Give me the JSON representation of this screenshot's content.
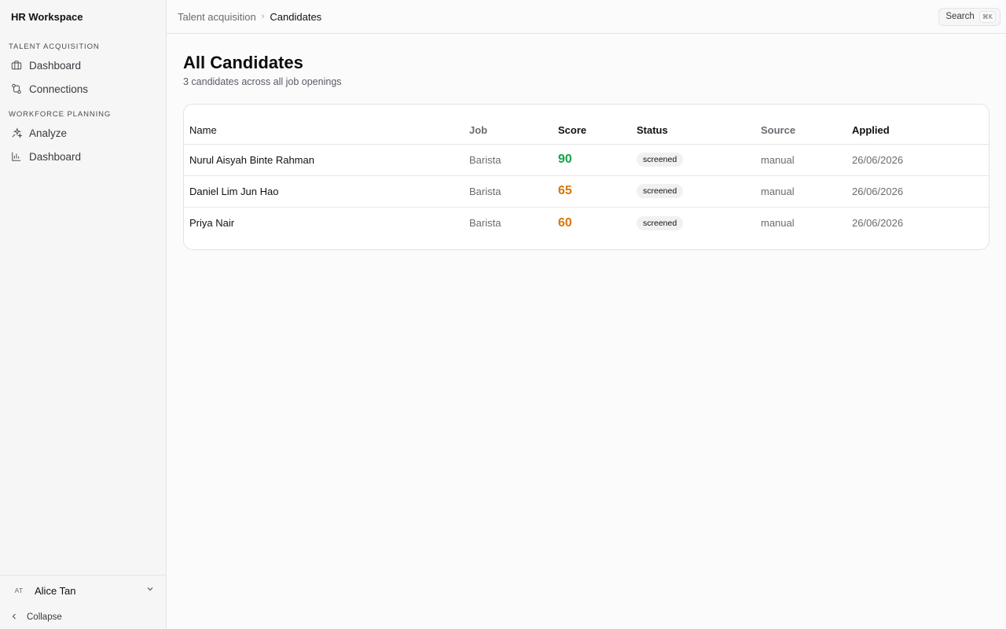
{
  "app": {
    "title": "HR Workspace"
  },
  "sidebar": {
    "sections": [
      {
        "label": "TALENT ACQUISITION",
        "items": [
          {
            "label": "Dashboard",
            "icon": "briefcase-icon"
          },
          {
            "label": "Connections",
            "icon": "connections-icon"
          }
        ]
      },
      {
        "label": "WORKFORCE PLANNING",
        "items": [
          {
            "label": "Analyze",
            "icon": "sparkle-icon"
          },
          {
            "label": "Dashboard",
            "icon": "bar-chart-icon"
          }
        ]
      }
    ],
    "user": {
      "initials": "AT",
      "name": "Alice Tan"
    },
    "collapse_label": "Collapse"
  },
  "breadcrumb": {
    "parent": "Talent acquisition",
    "separator": "›",
    "current": "Candidates"
  },
  "search": {
    "label": "Search",
    "shortcut": "⌘K"
  },
  "page": {
    "title": "All Candidates",
    "subtitle": "3 candidates across all job openings"
  },
  "table": {
    "headers": [
      "Name",
      "Job",
      "Score",
      "Status",
      "Source",
      "Applied"
    ],
    "rows": [
      {
        "name": "Nurul Aisyah Binte Rahman",
        "job": "Barista",
        "score": "90",
        "score_color": "#16a34a",
        "status": "screened",
        "source": "manual",
        "applied": "26/06/2026"
      },
      {
        "name": "Daniel Lim Jun Hao",
        "job": "Barista",
        "score": "65",
        "score_color": "#d97706",
        "status": "screened",
        "source": "manual",
        "applied": "26/06/2026"
      },
      {
        "name": "Priya Nair",
        "job": "Barista",
        "score": "60",
        "score_color": "#d97706",
        "status": "screened",
        "source": "manual",
        "applied": "26/06/2026"
      }
    ]
  }
}
